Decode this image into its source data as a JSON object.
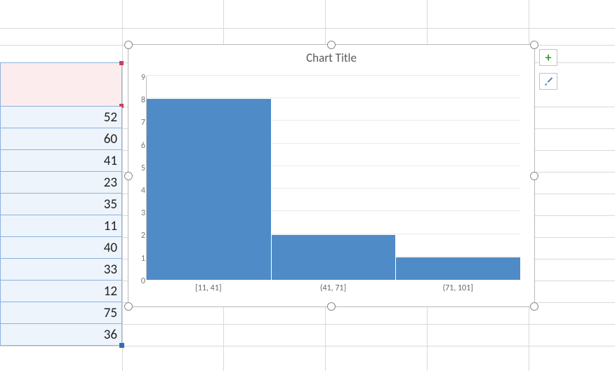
{
  "chart_data": {
    "type": "bar",
    "title": "Chart Title",
    "categories": [
      "[11, 41]",
      "(41, 71]",
      "(71, 101]"
    ],
    "values": [
      8,
      2,
      1
    ],
    "ylabel": "",
    "xlabel": "",
    "ylim": [
      0,
      9
    ],
    "yticks": [
      0,
      1,
      2,
      3,
      4,
      5,
      6,
      7,
      8,
      9
    ]
  },
  "data_column": {
    "header_selected": true,
    "values": [
      52,
      60,
      41,
      23,
      35,
      11,
      40,
      33,
      12,
      75,
      36
    ]
  },
  "side_buttons": {
    "add_element_label": "+",
    "style_label": "brush"
  }
}
